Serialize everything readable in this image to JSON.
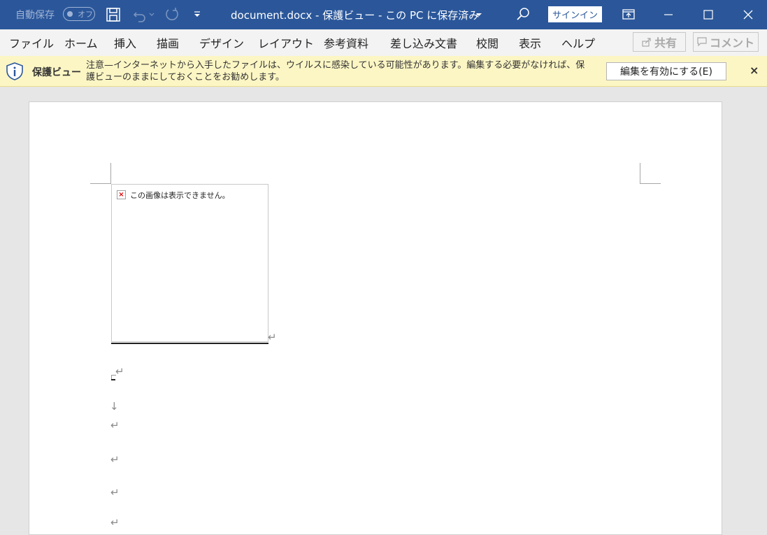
{
  "titlebar": {
    "autosave_label": "自動保存",
    "autosave_toggle": "オフ",
    "title": "document.docx  -  保護ビュー  -  この PC に保存済み",
    "signin_label": "サインイン"
  },
  "menu": {
    "items": [
      "ファイル",
      "ホーム",
      "挿入",
      "描画",
      "デザイン",
      "レイアウト",
      "参考資料",
      "差し込み文書",
      "校閲",
      "表示",
      "ヘルプ"
    ],
    "share_label": "共有",
    "comment_label": "コメント"
  },
  "protected_view": {
    "title": "保護ビュー",
    "message": "注意—インターネットから入手したファイルは、ウイルスに感染している可能性があります。編集する必要がなければ、保護ビューのままにしておくことをお勧めします。",
    "enable_editing_label": "編集を有効にする(E)",
    "close_label": "×"
  },
  "document": {
    "image_error_text": "この画像は表示できません。",
    "paragraph_mark": "↵",
    "line_break_mark": "↓"
  },
  "colors": {
    "titlebar": "#2b579a",
    "menubar": "#f3f3f3",
    "protected_bar": "#fcf6c4",
    "workspace": "#e6e6e6"
  }
}
